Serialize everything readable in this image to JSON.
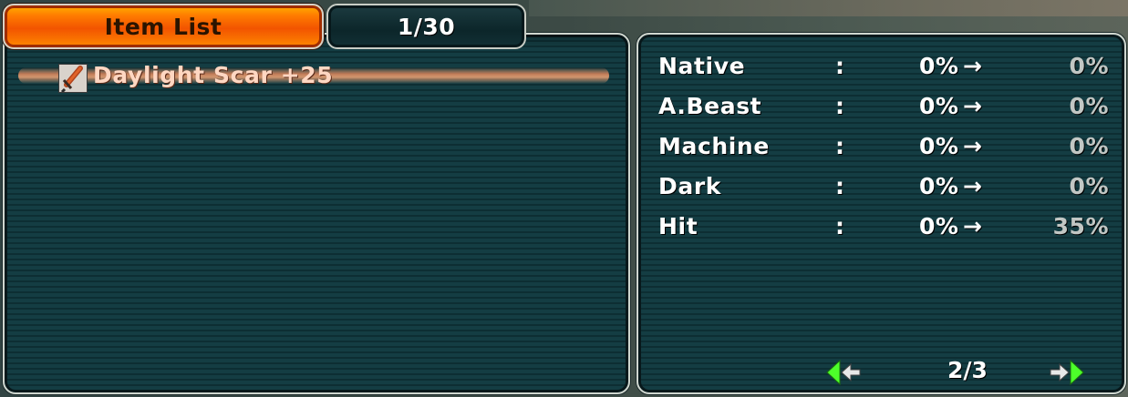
{
  "tabs": {
    "item_list_label": "Item List",
    "count_label": "1/30"
  },
  "items": [
    {
      "name": "Daylight Scar +25",
      "icon": "sword-icon"
    }
  ],
  "stats": [
    {
      "label": "Native",
      "colon": ":",
      "from": "0%",
      "arrow": "→",
      "to": "0%"
    },
    {
      "label": "A.Beast",
      "colon": ":",
      "from": "0%",
      "arrow": "→",
      "to": "0%"
    },
    {
      "label": "Machine",
      "colon": ":",
      "from": "0%",
      "arrow": "→",
      "to": "0%"
    },
    {
      "label": "Dark",
      "colon": ":",
      "from": "0%",
      "arrow": "→",
      "to": "0%"
    },
    {
      "label": "Hit",
      "colon": ":",
      "from": "0%",
      "arrow": "→",
      "to": "35%"
    }
  ],
  "pager": {
    "page_label": "2/3",
    "prev_icon": "prev-page-arrow-icon",
    "next_icon": "next-page-arrow-icon"
  },
  "colors": {
    "tab_active": "#ff7a00",
    "panel_bg": "#143d43",
    "item_highlight": "#ffaa78",
    "stat_to_dim": "#c2c7c4",
    "arrow_green": "#4dff2a"
  }
}
